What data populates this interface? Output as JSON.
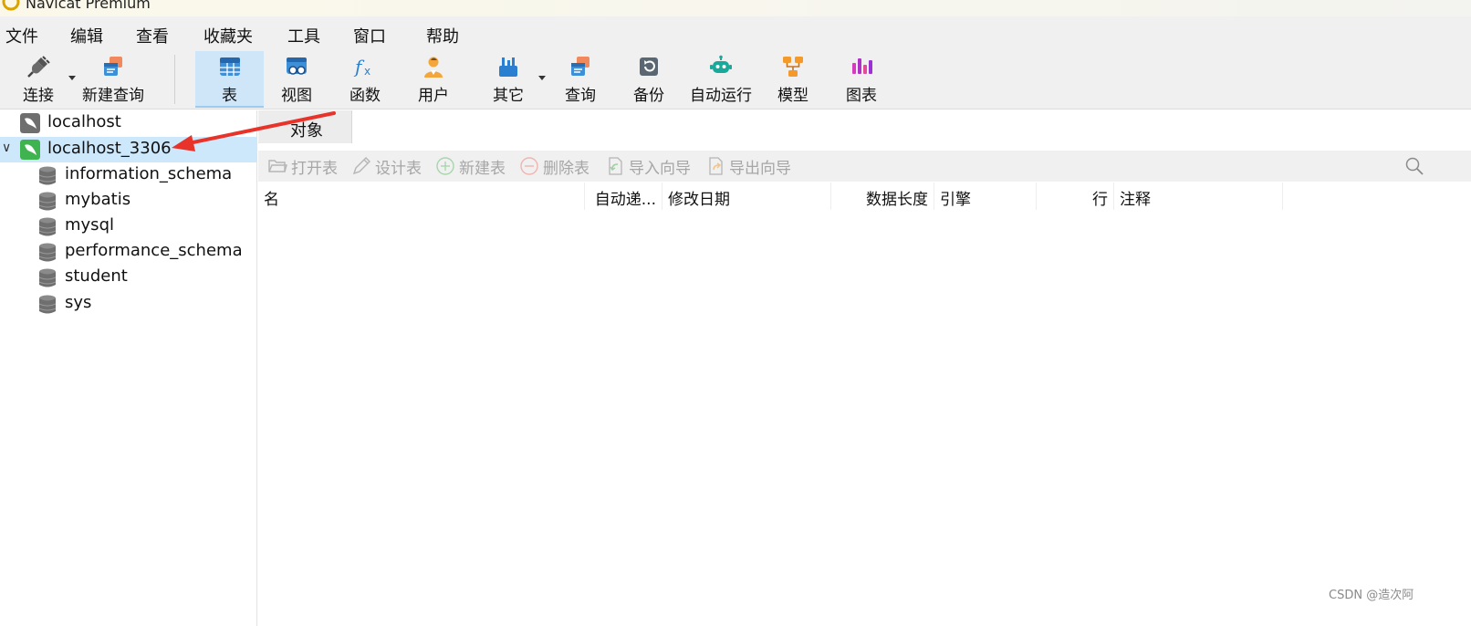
{
  "window": {
    "title": "Navicat Premium"
  },
  "menu": [
    "文件",
    "编辑",
    "查看",
    "收藏夹",
    "工具",
    "窗口",
    "帮助"
  ],
  "toolbar": {
    "connect": "连接",
    "new_query": "新建查询",
    "table": "表",
    "view": "视图",
    "function": "函数",
    "user": "用户",
    "other": "其它",
    "query": "查询",
    "backup": "备份",
    "automation": "自动运行",
    "model": "模型",
    "chart": "图表"
  },
  "tree": {
    "connections": [
      {
        "label": "localhost"
      },
      {
        "label": "localhost_3306",
        "expanded": true,
        "selected": true
      }
    ],
    "databases": [
      "information_schema",
      "mybatis",
      "mysql",
      "performance_schema",
      "student",
      "sys"
    ]
  },
  "tabs": {
    "objects": "对象"
  },
  "object_toolbar": {
    "open_table": "打开表",
    "design_table": "设计表",
    "new_table": "新建表",
    "delete_table": "删除表",
    "import_wizard": "导入向导",
    "export_wizard": "导出向导"
  },
  "columns": {
    "name": "名",
    "auto_increment": "自动递...",
    "modified_date": "修改日期",
    "data_length": "数据长度",
    "engine": "引擎",
    "rows": "行",
    "comment": "注释"
  },
  "watermark": "CSDN @造次阿",
  "colors": {
    "accent": "#cfe6f8",
    "selected_row": "#cde8fb",
    "annotation_arrow": "#e8332a",
    "mysql_green": "#3fb34f"
  }
}
